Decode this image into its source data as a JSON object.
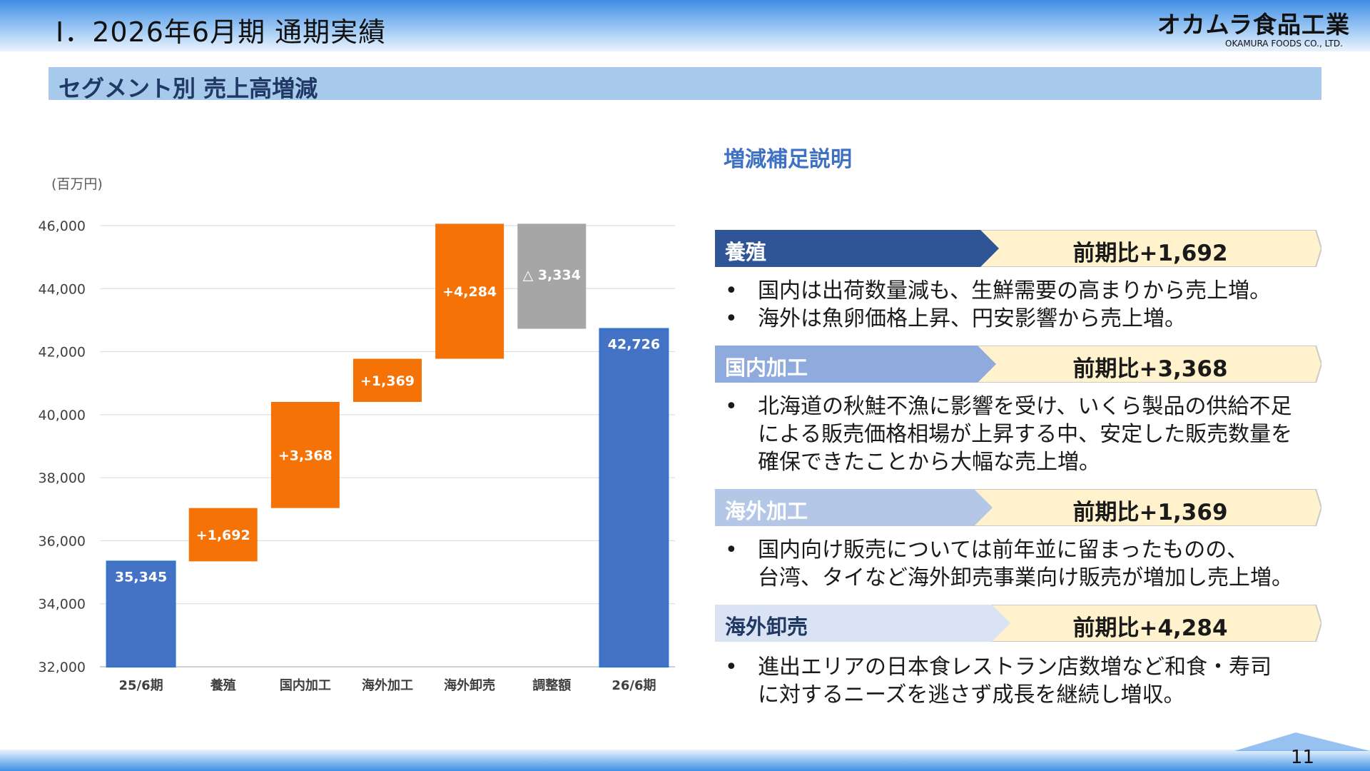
{
  "header": {
    "title": "Ⅰ．2026年6月期 通期実績",
    "logo_jp": "オカムラ食品工業",
    "logo_en": "OKAMURA FOODS CO., LTD."
  },
  "section_title": "セグメント別 売上高増減",
  "chart_data": {
    "type": "waterfall",
    "unit": "(百万円)",
    "categories": [
      "25/6期",
      "養殖",
      "国内加工",
      "海外加工",
      "海外卸売",
      "調整額",
      "26/6期"
    ],
    "base": 32000,
    "bars": [
      {
        "kind": "total",
        "start": 32000,
        "end": 35345,
        "label": "35,345",
        "color": "#4472c4"
      },
      {
        "kind": "increase",
        "start": 35345,
        "end": 37037,
        "label": "+1,692",
        "color": "#f57306"
      },
      {
        "kind": "increase",
        "start": 37037,
        "end": 40405,
        "label": "+3,368",
        "color": "#f57306"
      },
      {
        "kind": "increase",
        "start": 40405,
        "end": 41774,
        "label": "+1,369",
        "color": "#f57306"
      },
      {
        "kind": "increase",
        "start": 41774,
        "end": 46058,
        "label": "+4,284",
        "color": "#f57306"
      },
      {
        "kind": "decrease",
        "start": 46058,
        "end": 42726,
        "label": "△ 3,334",
        "color": "#a6a6a6"
      },
      {
        "kind": "total",
        "start": 32000,
        "end": 42726,
        "label": "42,726",
        "color": "#4472c4"
      }
    ],
    "yticks": [
      "32,000",
      "34,000",
      "36,000",
      "38,000",
      "40,000",
      "42,000",
      "44,000",
      "46,000"
    ],
    "ylim": [
      32000,
      46000
    ],
    "grid": true
  },
  "explain": {
    "heading": "増減補足説明",
    "segments": [
      {
        "name": "養殖",
        "change": "前期比+1,692",
        "head_color": "#2f5597",
        "name_color": "#ffffff",
        "bullets": [
          "国内は出荷数量減も、生鮮需要の高まりから売上増。",
          "海外は魚卵価格上昇、円安影響から売上増。"
        ]
      },
      {
        "name": "国内加工",
        "change": "前期比+3,368",
        "head_color": "#8faadc",
        "name_color": "#ffffff",
        "bullets": [
          "北海道の秋鮭不漁に影響を受け、いくら製品の供給不足",
          "による販売価格相場が上昇する中、安定した販売数量を",
          "確保できたことから大幅な売上増。"
        ]
      },
      {
        "name": "海外加工",
        "change": "前期比+1,369",
        "head_color": "#b4c7e7",
        "name_color": "#ffffff",
        "bullets": [
          "国内向け販売については前年並に留まったものの、",
          "台湾、タイなど海外卸売事業向け販売が増加し売上増。"
        ]
      },
      {
        "name": "海外卸売",
        "change": "前期比+4,284",
        "head_color": "#dae3f3",
        "name_color": "#1f3864",
        "bullets": [
          "進出エリアの日本食レストラン店数増など和食・寿司",
          "に対するニーズを逃さず成長を継続し増収。"
        ]
      }
    ]
  },
  "colors": {
    "ribbon_fill": "#fff2cc",
    "ribbon_stroke": "#c9c9c9",
    "accent": "#3e70c4"
  },
  "footer": {
    "page_number": "11"
  }
}
